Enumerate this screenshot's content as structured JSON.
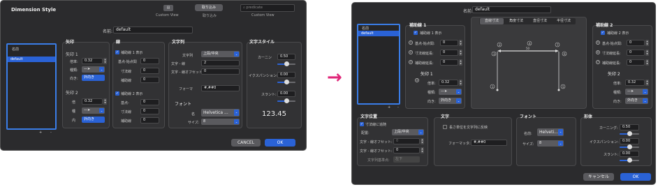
{
  "left": {
    "title": "Dimension Style",
    "toolbar": {
      "btn1_label": "取り込み",
      "icon_label": "Custom View",
      "btn2_label": "取り込み",
      "search_placeholder": "predicate",
      "search_caption": "Custom View"
    },
    "name_label": "名前:",
    "name_value": "default",
    "list": {
      "header": "名前",
      "items": [
        "default"
      ]
    },
    "arrows": {
      "title": "矢印",
      "head1": "矢印 1",
      "size_label": "倍率:",
      "size_value": "0.32",
      "kind_label": "種類:",
      "dir_label": "向き:",
      "dir_value": "外向き",
      "head2": "矢印 2",
      "size2_label": "倍",
      "size2_value": "0.32",
      "kind2_label": "種",
      "dir2_label": "内",
      "dir2_value": "外向き"
    },
    "lines": {
      "title": "線",
      "ext1_label": "補助線 1 表示",
      "base_offset": "基点-始点間",
      "base_offset_value": "0",
      "ext_len": "寸法線",
      "ext_len_value": "0",
      "aux": "補助線",
      "aux_value": "0",
      "ext2_label": "補助線 2 表示",
      "base2": "基点-",
      "base2_value": "0",
      "ext2_len": "寸法線",
      "ext2_len_value": "0",
      "aux2": "補助線",
      "aux2_value": "0"
    },
    "text": {
      "title": "文字列",
      "pos_label": "文字列",
      "pos_value": "上段/中央",
      "gap_label": "文字 - 線",
      "gap_value": "2",
      "offset_label": "文字 - 線オフセット:",
      "offset_value": "0",
      "format_label": "フォーマ",
      "format_value": "#,##0",
      "font_title": "フォント",
      "fname_label": "名",
      "fname_value": "Helvetica ...",
      "fsize_label": "サイズ:",
      "fsize_value": "8"
    },
    "style": {
      "title": "文字スタイル",
      "kern_label": "カーニン",
      "kern_value": "0.50",
      "exp_label": "イクスパンション:",
      "exp_value": "0.00",
      "slant_label": "スラント:",
      "slant_value": "0.00",
      "preview": "123.45"
    },
    "cancel": "CANCEL",
    "ok": "OK",
    "plus": "+",
    "minus": "-"
  },
  "arrow_glyph": "→",
  "right": {
    "name_label": "名前:",
    "name_value": "default",
    "list": {
      "header": "名前",
      "items": [
        "default"
      ]
    },
    "ext1": {
      "title": "補助線 1",
      "show_label": "補助線 1 表示",
      "base_label": "基点-始点間:",
      "base_value": "0",
      "len_label": "寸法線延長:",
      "len_value": "0",
      "aux_label": "補助線延長:",
      "aux_value": "0",
      "arrow_title": "矢印 1",
      "size_label": "倍率:",
      "size_value": "0.32",
      "kind_label": "種類:",
      "dir_label": "向き:",
      "dir_value": "外向き"
    },
    "tabs": [
      "直線寸法",
      "角度寸法",
      "直径寸法",
      "半径寸法"
    ],
    "preview": {
      "dim_text": "50",
      "labels": [
        "1",
        "2",
        "3",
        "4",
        "5",
        "6",
        "7"
      ]
    },
    "ext2": {
      "title": "補助線 2",
      "show_label": "補助線 2 表示",
      "base_label": "基点-始点間:",
      "base_value": "0",
      "len_label": "寸法線延長:",
      "len_value": "0",
      "aux_label": "補助線延長:",
      "aux_value": "0",
      "arrow_title": "矢印 2",
      "size_label": "倍率:",
      "size_value": "0.32",
      "kind_label": "種類:",
      "dir_label": "向き:",
      "dir_value": "外向き"
    },
    "textpos": {
      "title": "文字位置",
      "follow_label": "寸法線に追随",
      "pos_label": "配置:",
      "pos_value": "上段/中央",
      "xoff_label": "文字 - 線オフセット:",
      "xoff_value": "0",
      "yoff_label": "文字 - 線オフセット:",
      "yoff_value": "0",
      "anchor_label": "文字列基準点:",
      "anchor_value": "左下"
    },
    "text": {
      "title": "文字",
      "unit_label": "長さ単位を文字列に反映",
      "format_label": "フォーマッタ:",
      "format_value": "#,##0"
    },
    "font": {
      "title": "フォント",
      "name_label": "名前:",
      "name_value": "Helveti...",
      "size_label": "サイズ:",
      "size_value": "8"
    },
    "shape": {
      "title": "形体",
      "kern_label": "カーニング:",
      "kern_value": "0.50",
      "exp_label": "イクスパンション:",
      "exp_value": "0.00",
      "slant_label": "スラント:",
      "slant_value": "0.00"
    },
    "cancel": "キャンセル",
    "ok": "OK",
    "plus": "+",
    "minus": "-"
  },
  "colors": {
    "accent": "#2a62d6",
    "arrow": "#e0287a",
    "window": "#2b2b2d"
  }
}
